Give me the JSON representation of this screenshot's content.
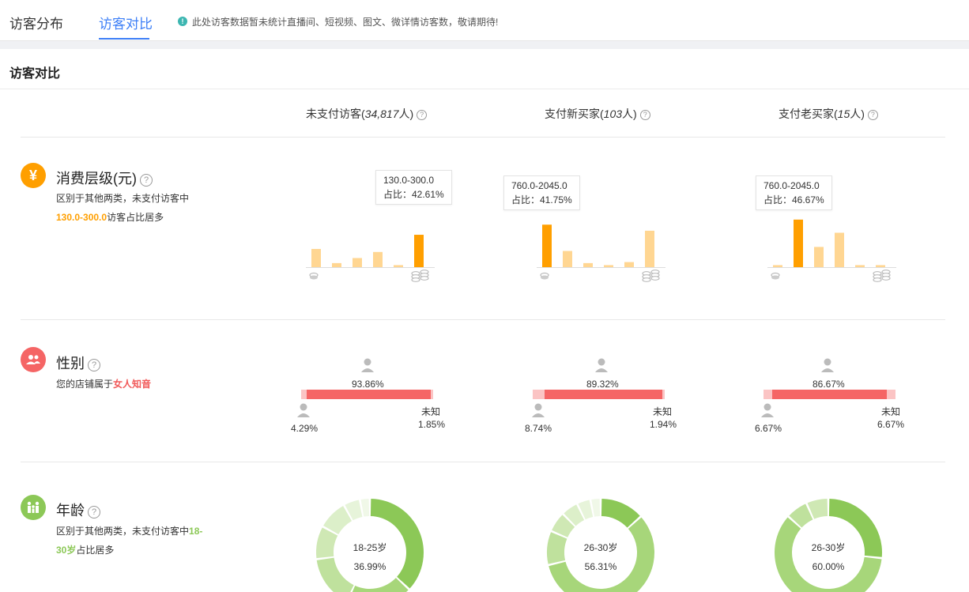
{
  "tabs": [
    {
      "label": "访客分布",
      "active": false
    },
    {
      "label": "访客对比",
      "active": true
    }
  ],
  "notice": {
    "icon": "info-icon",
    "text": "此处访客数据暂未统计直播间、短视频、图文、微详情访客数，敬请期待!"
  },
  "panel": {
    "title": "访客对比"
  },
  "columns": [
    {
      "label": "未支付访客(",
      "count": "34,817",
      "suffix": "人)"
    },
    {
      "label": "支付新买家(",
      "count": "103",
      "suffix": "人)"
    },
    {
      "label": "支付老买家(",
      "count": "15",
      "suffix": "人)"
    }
  ],
  "consumption": {
    "icon": "yuan-icon",
    "title": "消费层级(元)",
    "desc_line1": "区别于其他两类，未支付访客中",
    "desc_highlight": "130.0-300.0",
    "desc_tail": "访客占比居多",
    "charts": [
      {
        "tooltip_range": "130.0-300.0",
        "tooltip_pct": "占比：42.61%",
        "values": [
          18,
          4,
          9,
          15,
          2,
          32
        ],
        "highlight": 5
      },
      {
        "tooltip_range": "760.0-2045.0",
        "tooltip_pct": "占比：41.75%",
        "values": [
          42,
          16,
          4,
          2,
          5,
          36
        ],
        "highlight": 0
      },
      {
        "tooltip_range": "760.0-2045.0",
        "tooltip_pct": "占比：46.67%",
        "values": [
          2,
          47,
          20,
          34,
          2,
          2
        ],
        "highlight": 1
      }
    ],
    "colors": {
      "highlight": "#ff9f00",
      "normal": "#ffd692"
    }
  },
  "gender": {
    "icon": "users-icon",
    "title": "性别",
    "desc_prefix": "您的店铺属于",
    "desc_highlight": "女人知音",
    "unknown_label": "未知",
    "columns": [
      {
        "female": "93.86%",
        "male": "4.29%",
        "unknown": "1.85%",
        "female_frac": 0.9386,
        "male_frac": 0.0429
      },
      {
        "female": "89.32%",
        "male": "8.74%",
        "unknown": "1.94%",
        "female_frac": 0.8932,
        "male_frac": 0.0874
      },
      {
        "female": "86.67%",
        "male": "6.67%",
        "unknown": "6.67%",
        "female_frac": 0.8667,
        "male_frac": 0.0667
      }
    ]
  },
  "age": {
    "icon": "family-icon",
    "title": "年龄",
    "desc_line1_prefix": "区别于其他两类，未支付访客中",
    "desc_line1_hl": "18-",
    "desc_line2_hl": "30岁",
    "desc_line2_tail": "占比居多",
    "donuts": [
      {
        "label": "18-25岁",
        "value": "36.99%",
        "fractions": [
          0.3699,
          0.2,
          0.16,
          0.1,
          0.09,
          0.05,
          0.03
        ]
      },
      {
        "label": "26-30岁",
        "value": "56.31%",
        "fractions": [
          0.13,
          0.5631,
          0.1,
          0.06,
          0.05,
          0.04,
          0.03
        ]
      },
      {
        "label": "26-30岁",
        "value": "60.00%",
        "fractions": [
          0.2667,
          0.6,
          0.0666,
          0.0667
        ]
      }
    ],
    "colors": [
      "#8cc857",
      "#a7d67a",
      "#bfe19d",
      "#cfe8b4",
      "#dcefc9",
      "#e7f4da",
      "#f0f8e8"
    ]
  }
}
